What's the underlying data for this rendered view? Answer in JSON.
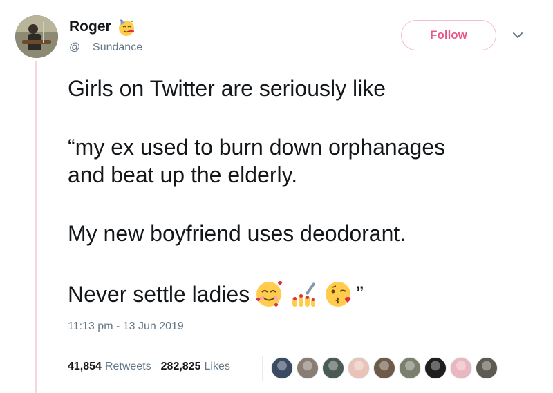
{
  "user": {
    "display_name": "Roger",
    "handle": "@__Sundance__",
    "name_emoji": "partying-face-emoji"
  },
  "actions": {
    "follow_label": "Follow",
    "menu_icon": "chevron-down-icon"
  },
  "tweet": {
    "lines": [
      "Girls on Twitter are seriously like",
      "“my ex used to burn down orphanages",
      "and beat up the elderly.",
      "My new boyfriend uses deodorant.",
      "Never settle ladies"
    ],
    "closing_quote": "”",
    "emojis": [
      "smiling-face-with-hearts-emoji",
      "nail-polish-emoji",
      "face-blowing-a-kiss-emoji"
    ],
    "timestamp": "11:13 pm - 13 Jun 2019"
  },
  "stats": {
    "retweets_count": "41,854",
    "retweets_label": "Retweets",
    "likes_count": "282,825",
    "likes_label": "Likes"
  },
  "likers": [
    {
      "name": "liker-avatar-1",
      "color": "#3b4a63"
    },
    {
      "name": "liker-avatar-2",
      "color": "#8a7d74"
    },
    {
      "name": "liker-avatar-3",
      "color": "#4b5a55"
    },
    {
      "name": "liker-avatar-4",
      "color": "#e8c4b8"
    },
    {
      "name": "liker-avatar-5",
      "color": "#6d5a48"
    },
    {
      "name": "liker-avatar-6",
      "color": "#7a7f6e"
    },
    {
      "name": "liker-avatar-7",
      "color": "#1e1e1e"
    },
    {
      "name": "liker-avatar-8",
      "color": "#e9b7c0"
    },
    {
      "name": "liker-avatar-9",
      "color": "#5d5a52"
    }
  ],
  "colors": {
    "accent": "#e0245e",
    "thread_line": "#f9d6dd",
    "secondary_text": "#657786"
  }
}
